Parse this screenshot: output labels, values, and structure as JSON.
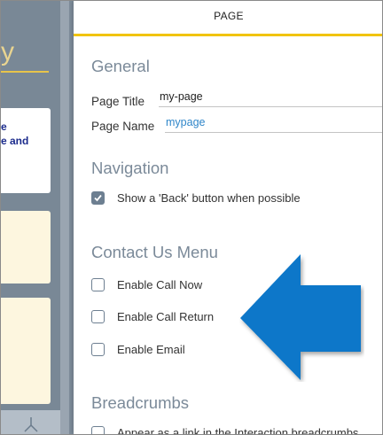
{
  "background": {
    "title_fragment": "y",
    "card_text_line1": "e",
    "card_text_line2": "e and"
  },
  "panel": {
    "header": "PAGE",
    "general": {
      "title": "General",
      "page_title_label": "Page Title",
      "page_title_value": "my-page",
      "page_name_label": "Page Name",
      "page_name_value": "mypage"
    },
    "navigation": {
      "title": "Navigation",
      "back_button_label": "Show a 'Back' button when possible",
      "back_button_checked": true
    },
    "contact_us": {
      "title": "Contact Us Menu",
      "call_now_label": "Enable Call Now",
      "call_return_label": "Enable Call Return",
      "email_label": "Enable Email"
    },
    "breadcrumbs": {
      "title": "Breadcrumbs",
      "link_label": "Appear as a link in the Interaction breadcrumbs"
    }
  },
  "colors": {
    "accent_yellow": "#f1c40f",
    "arrow_blue": "#0a77c9",
    "section_title": "#7b8a99",
    "link_blue": "#2f86c9"
  }
}
